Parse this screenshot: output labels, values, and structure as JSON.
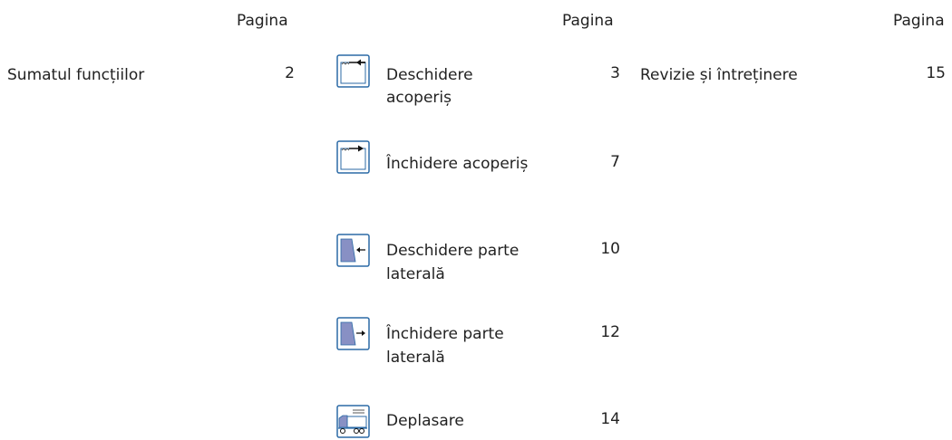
{
  "col1": {
    "header": "Pagina",
    "entries": [
      {
        "label": "Sumatul funcțiilor",
        "page": "2"
      }
    ]
  },
  "col2": {
    "header": "Pagina",
    "entries": [
      {
        "label_line1": "Deschidere",
        "label_line2": "acoperiș",
        "page": "3",
        "icon": "roof-open-icon"
      },
      {
        "label_line1": "Închidere acoperiș",
        "label_line2": "",
        "page": "7",
        "icon": "roof-close-icon"
      },
      {
        "label_line1": "Deschidere parte",
        "label_line2": "laterală",
        "page": "10",
        "icon": "side-open-icon"
      },
      {
        "label_line1": "Închidere parte",
        "label_line2": "laterală",
        "page": "12",
        "icon": "side-close-icon"
      },
      {
        "label_line1": "Deplasare",
        "label_line2": "",
        "page": "14",
        "icon": "truck-icon"
      }
    ]
  },
  "col3": {
    "header": "Pagina",
    "entries": [
      {
        "label": "Revizie și întreținere",
        "page": "15"
      }
    ]
  },
  "colors": {
    "icon_frame": "#2b6aa6",
    "icon_fill": "#8890c4",
    "text": "#222222"
  }
}
